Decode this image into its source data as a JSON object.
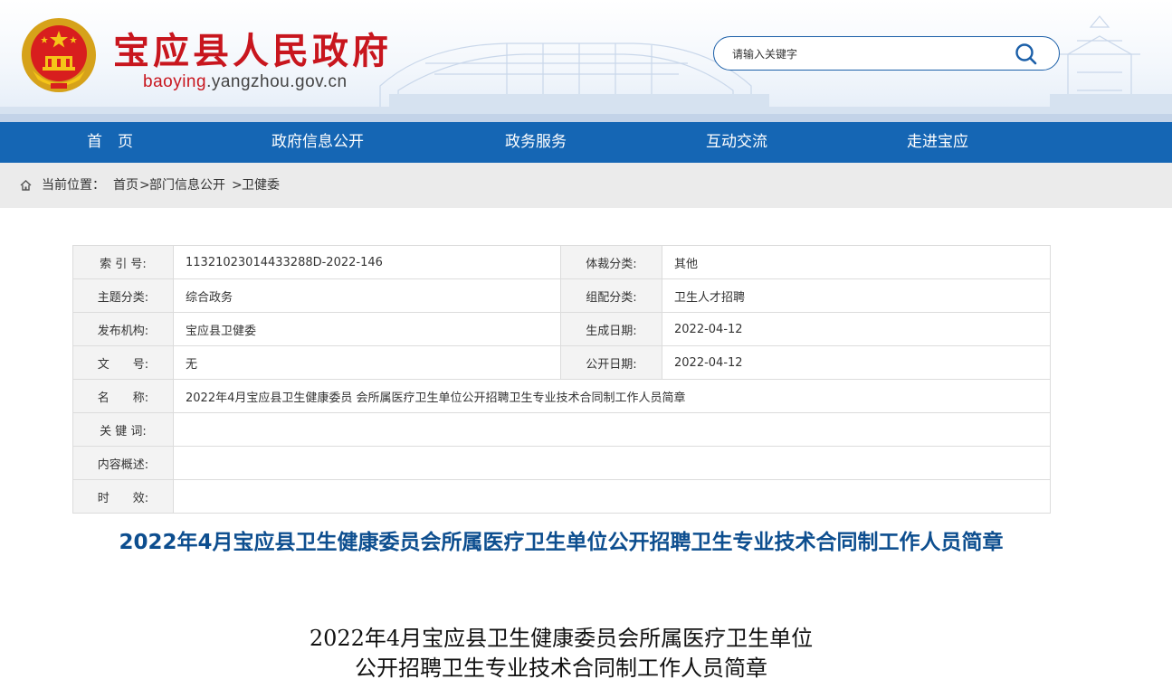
{
  "header": {
    "site_title": "宝应县人民政府",
    "domain_highlight": "baoying",
    "domain_rest": ".yangzhou.gov.cn",
    "search_placeholder": "请输入关键字",
    "brand_red": "#c8161e",
    "brand_blue": "#1566b4"
  },
  "nav": {
    "items": [
      "首　页",
      "政府信息公开",
      "政务服务",
      "互动交流",
      "走进宝应"
    ]
  },
  "breadcrumb": {
    "prefix": "当前位置：",
    "home": "首页",
    "sep1": ">",
    "section": "部门信息公开",
    "sep2": ">",
    "current": "卫健委"
  },
  "info": {
    "index_label": "索 引 号:",
    "index_value": "11321023014433288D-2022-146",
    "genre_label": "体裁分类:",
    "genre_value": "其他",
    "topic_label": "主题分类:",
    "topic_value": "综合政务",
    "config_label": "组配分类:",
    "config_value": "卫生人才招聘",
    "publisher_label": "发布机构:",
    "publisher_value": "宝应县卫健委",
    "created_label": "生成日期:",
    "created_value": "2022-04-12",
    "docno_label": "文　　号:",
    "docno_value": "无",
    "public_label": "公开日期:",
    "public_value": "2022-04-12",
    "name_label": "名　　称:",
    "name_value": "2022年4月宝应县卫生健康委员 会所属医疗卫生单位公开招聘卫生专业技术合同制工作人员简章",
    "keywords_label": "关 键 词:",
    "keywords_value": "",
    "summary_label": "内容概述:",
    "summary_value": "",
    "validity_label": "时　　效:",
    "validity_value": ""
  },
  "article": {
    "title": "2022年4月宝应县卫生健康委员会所属医疗卫生单位公开招聘卫生专业技术合同制工作人员简章",
    "body_title_line1": "2022年4月宝应县卫生健康委员会所属医疗卫生单位",
    "body_title_line2": "公开招聘卫生专业技术合同制工作人员简章"
  }
}
